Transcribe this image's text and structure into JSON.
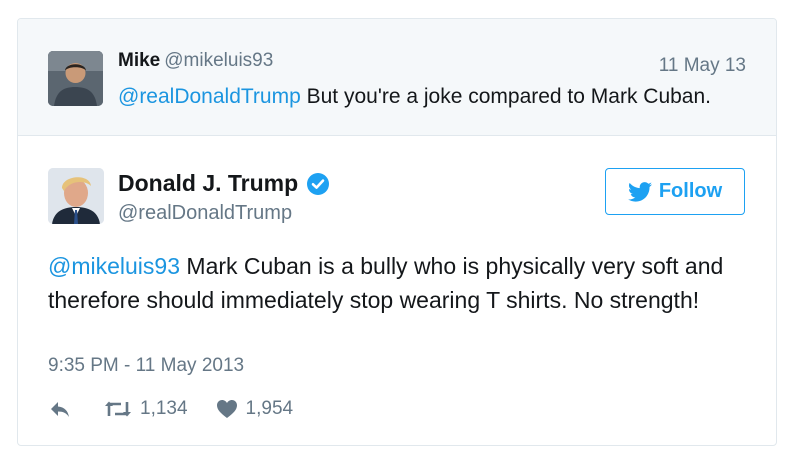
{
  "parent_tweet": {
    "name": "Mike",
    "handle": "@mikeluis93",
    "date": "11 May 13",
    "mention": "@realDonaldTrump",
    "text": " But you're a joke compared to Mark Cuban."
  },
  "main_tweet": {
    "name": "Donald J. Trump",
    "handle": "@realDonaldTrump",
    "follow_label": "Follow",
    "mention": "@mikeluis93",
    "text": " Mark Cuban is a bully who is physically very soft and therefore should immediately stop wearing T shirts. No strength!",
    "timestamp": "9:35 PM - 11 May 2013",
    "retweets": "1,134",
    "likes": "1,954"
  },
  "icons": {
    "verified": "verified-badge-icon",
    "follow": "twitter-bird-icon",
    "reply": "reply-icon",
    "retweet": "retweet-icon",
    "like": "heart-icon"
  },
  "colors": {
    "link": "#1b95e0",
    "follow_blue": "#1da1f2",
    "secondary_text": "#657786",
    "parent_background": "#f5f8fa",
    "border": "#e1e8ed"
  }
}
